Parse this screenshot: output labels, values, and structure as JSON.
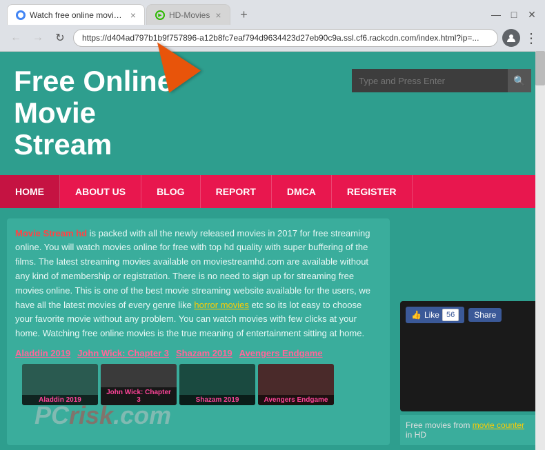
{
  "browser": {
    "tabs": [
      {
        "id": "tab1",
        "favicon_type": "circle",
        "label": "Watch free online movie stream...",
        "active": true
      },
      {
        "id": "tab2",
        "favicon_type": "green",
        "label": "HD-Movies",
        "active": false
      }
    ],
    "new_tab_symbol": "+",
    "window_controls": [
      "—",
      "□",
      "✕"
    ],
    "address": "https://d404ad797b1b9f757896-a12b8fc7eaf794d9634423d27eb90c9a.ssl.cf6.rackcdn.com/index.html?ip=...",
    "nav": {
      "back_symbol": "←",
      "forward_symbol": "→",
      "refresh_symbol": "↻"
    }
  },
  "site": {
    "logo_line1": "Free Online",
    "logo_line2": "Movie",
    "logo_line3": "Stream",
    "search_placeholder": "Type and Press Enter",
    "search_icon": "🔍",
    "nav_items": [
      "HOME",
      "ABOUT US",
      "BLOG",
      "REPORT",
      "DMCA",
      "REGISTER"
    ],
    "body_text_part1": "Movie Stream hd",
    "body_text_part2": " is packed with all the newly released movies in 2017 for free streaming online. You will watch movies online for free with top hd quality with super buffering of the films. The latest streaming movies available on moviestreamhd.com are available without any kind of membership or registration. There is no need to sign up for streaming free movies online. This is one of the best movie streaming website available for the users, we have all the latest movies of every genre like ",
    "body_text_link": "horror movies",
    "body_text_part3": " etc so its lot easy to choose your favorite movie without any problem. You can watch movies with few clicks at your home. Watching free online movies is the true meaning of entertainment sitting at home.",
    "movie_links": [
      "Aladdin 2019",
      "John Wick: Chapter 3",
      "Shazam 2019",
      "Avengers Endgame"
    ],
    "fb_count": "56",
    "fb_like_label": "Like",
    "fb_share_label": "Share",
    "sidebar_caption_text": "Free movies from ",
    "sidebar_caption_link": "movie counter",
    "sidebar_caption_suffix": " in HD",
    "watermark": "PCrisk.com"
  }
}
